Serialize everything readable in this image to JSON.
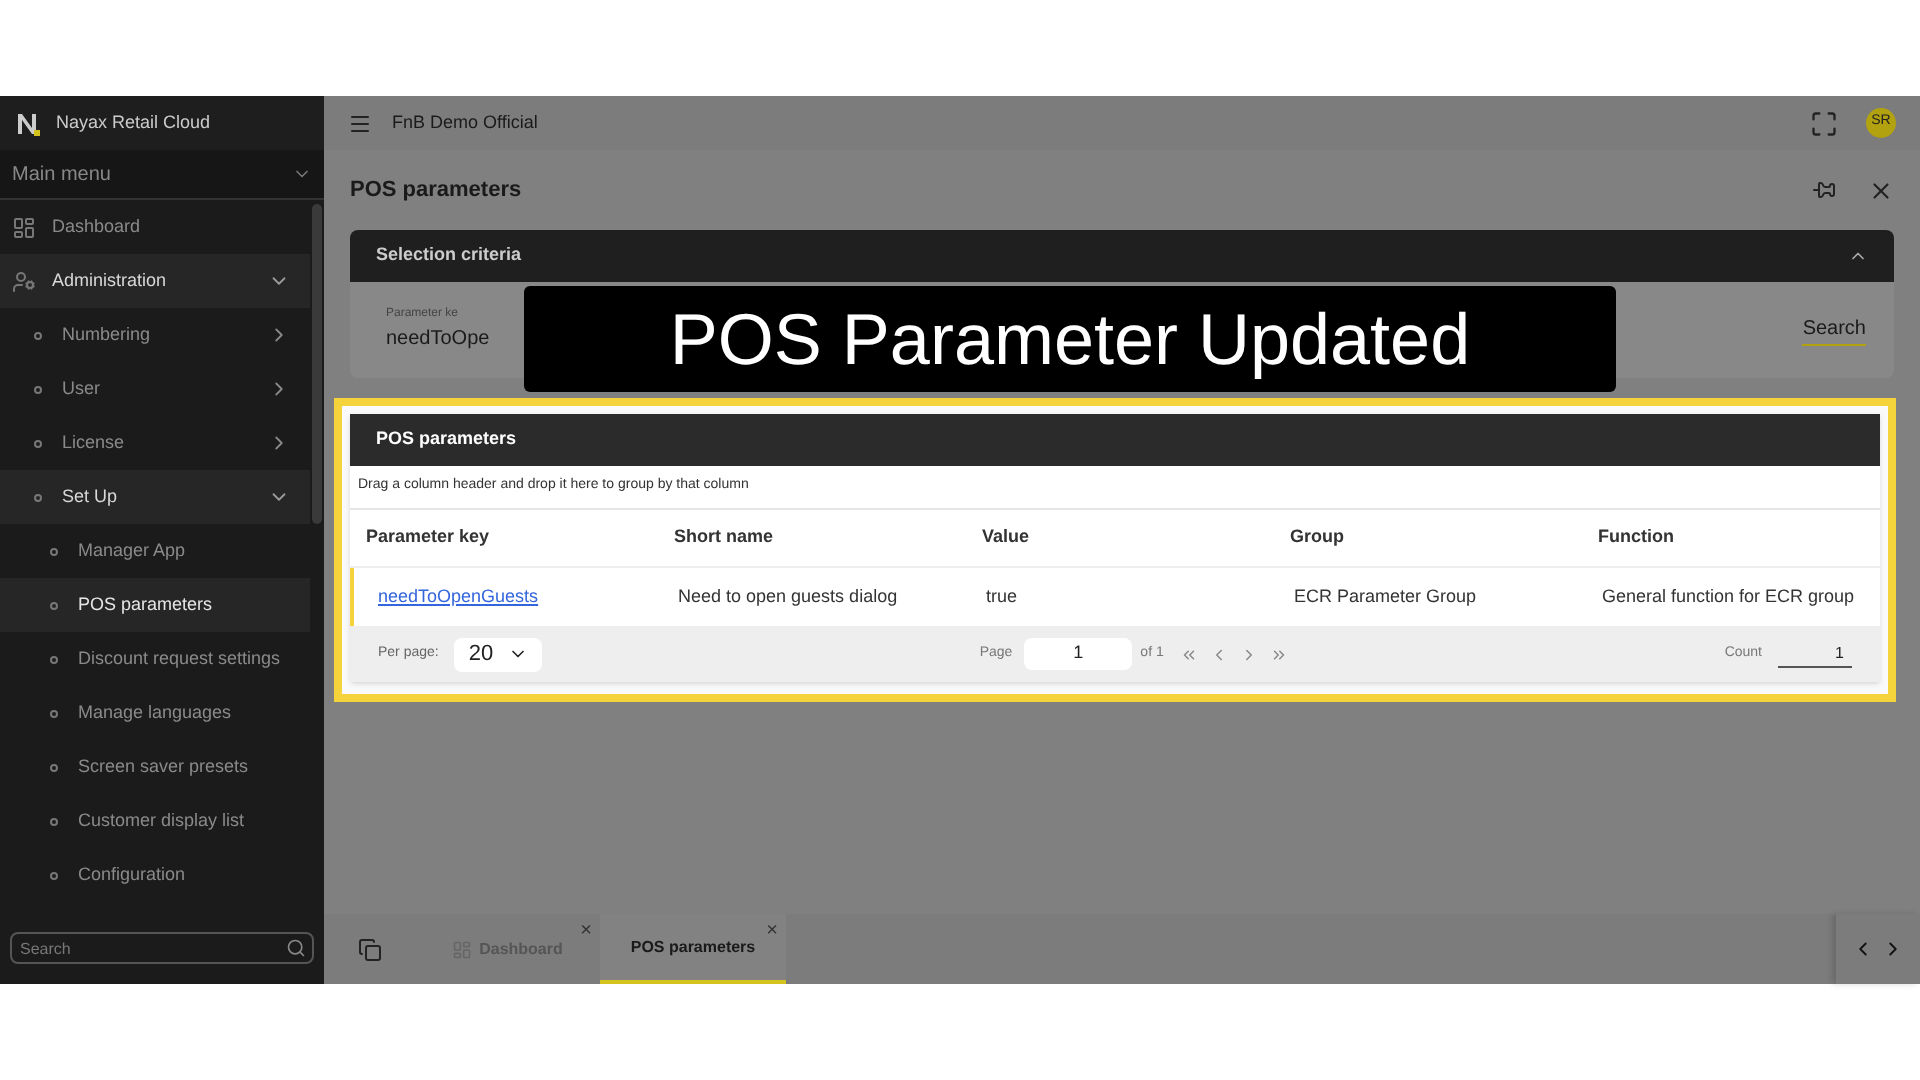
{
  "sidebar": {
    "brand": "Nayax Retail Cloud",
    "menu_title": "Main menu",
    "items": [
      {
        "label": "Dashboard",
        "selected": false
      },
      {
        "label": "Administration",
        "selected": false,
        "expanded": true,
        "children": [
          {
            "label": "Numbering",
            "selected": false,
            "expanded": false
          },
          {
            "label": "User",
            "selected": false,
            "expanded": false
          },
          {
            "label": "License",
            "selected": false,
            "expanded": false
          },
          {
            "label": "Set Up",
            "selected": false,
            "expanded": true,
            "children": [
              {
                "label": "Manager App",
                "selected": false
              },
              {
                "label": "POS parameters",
                "selected": true
              },
              {
                "label": "Discount request settings",
                "selected": false
              },
              {
                "label": "Manage languages",
                "selected": false
              },
              {
                "label": "Screen saver presets",
                "selected": false
              },
              {
                "label": "Customer display list",
                "selected": false
              },
              {
                "label": "Configuration",
                "selected": false
              }
            ]
          }
        ]
      }
    ],
    "search": {
      "placeholder": "Search"
    }
  },
  "topbar": {
    "title": "FnB Demo Official",
    "avatar": "SR"
  },
  "page": {
    "title": "POS parameters",
    "selection": {
      "title": "Selection criteria",
      "expanded": true,
      "field_label": "Parameter ke",
      "field_value": "needToOpe",
      "search_button": "Search"
    },
    "grid": {
      "title": "POS parameters",
      "group_hint": "Drag a column header and drop it here to group by that column",
      "columns": [
        "Parameter key",
        "Short name",
        "Value",
        "Group",
        "Function"
      ],
      "rows": [
        {
          "selected": true,
          "cells": [
            "needToOpenGuests",
            "Need to open guests dialog",
            "true",
            "ECR Parameter Group",
            "General function for ECR group"
          ]
        }
      ],
      "footer": {
        "per_page_label": "Per page:",
        "per_page": "20",
        "page_label": "Page",
        "page": "1",
        "of": "of 1",
        "count_label": "Count",
        "count": "1"
      }
    }
  },
  "tabs": [
    {
      "label": "Dashboard",
      "selected": false,
      "close": "×"
    },
    {
      "label": "POS parameters",
      "selected": true,
      "close": "×"
    }
  ],
  "caption": "POS Parameter Updated"
}
